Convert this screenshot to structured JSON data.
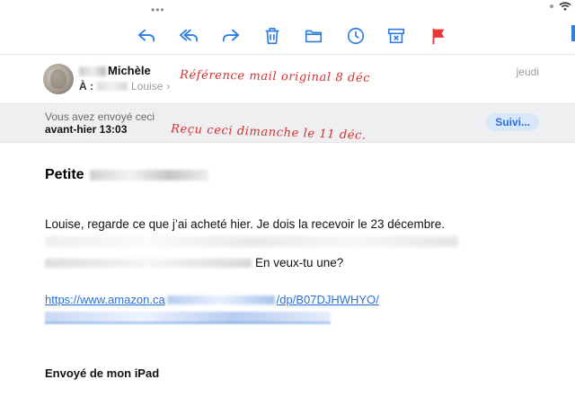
{
  "status_bar": {
    "dots": "•••"
  },
  "toolbar": {
    "buttons": [
      "reply",
      "reply-all",
      "forward",
      "trash",
      "folder",
      "clock",
      "archive",
      "flag"
    ],
    "accent_color": "#2f7ee3",
    "flag_color": "#e53935"
  },
  "message": {
    "sender_name": "Michèle",
    "to_label": "À :",
    "recipient_name": "Louise",
    "date": "jeudi",
    "banner_line1": "Vous avez envoyé ceci",
    "banner_line2": "avant-hier 13:03",
    "follow_button": "Suivi...",
    "subject_visible": "Petite",
    "body_line1": "Louise, regarde ce que j’ai acheté hier. Je dois la recevoir le 23 décembre.",
    "body_line3_visible": "En veux-tu une?",
    "link_visible_start": "https://www.amazon.ca",
    "link_visible_end": "/dp/B07DJHWHYO/",
    "signature": "Envoyé de mon iPad"
  },
  "annotations": {
    "note1": "Référence mail original 8 déc",
    "note2": "Reçu ceci dimanche le 11 déc.",
    "color": "#d32f2f"
  }
}
